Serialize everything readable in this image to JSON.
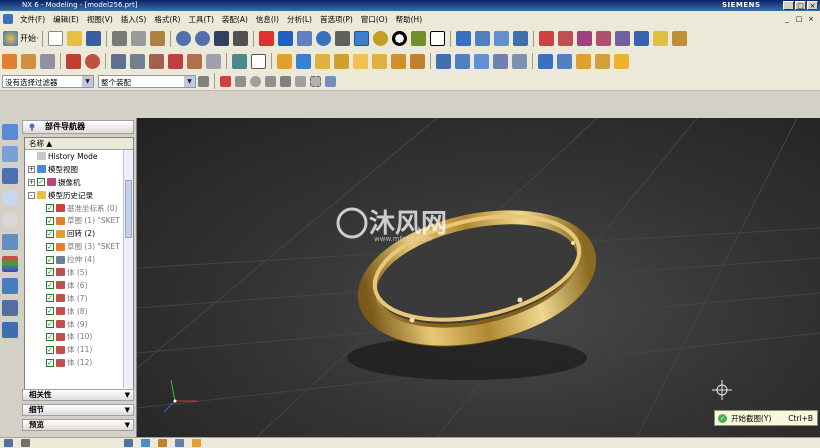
{
  "window": {
    "title": "NX 6 - Modeling - [model256.prt]",
    "brand": "SIEMENS",
    "controls": [
      "_",
      "□",
      "×"
    ]
  },
  "menubar": {
    "items": [
      "文件(F)",
      "编辑(E)",
      "视图(V)",
      "插入(S)",
      "格式(R)",
      "工具(T)",
      "装配(A)",
      "信息(I)",
      "分析(L)",
      "首选项(P)",
      "窗口(O)",
      "帮助(H)"
    ],
    "doc_controls": [
      "_",
      "□",
      "×"
    ]
  },
  "toolbar": {
    "start_label": "开始·"
  },
  "filter_bar": {
    "selection_filter": "没有选择过滤器",
    "assembly_scope": "整个装配"
  },
  "navigator": {
    "title": "部件导航器",
    "column_header": "名称 ▲",
    "tree": [
      {
        "label": "History Mode",
        "indent": 1,
        "icon": "clock-icon"
      },
      {
        "label": "模型视图",
        "indent": 0,
        "expander": "+",
        "icon": "views-icon"
      },
      {
        "label": "摄像机",
        "indent": 0,
        "expander": "+",
        "check": true,
        "icon": "camera-icon"
      },
      {
        "label": "模型历史记录",
        "indent": 0,
        "expander": "-",
        "icon": "folder-icon"
      },
      {
        "label": "基准坐标系 (0)",
        "indent": 2,
        "check": true,
        "icon": "datum-csys-icon",
        "grey": true
      },
      {
        "label": "草图 (1) \"SKET",
        "indent": 2,
        "check": true,
        "icon": "sketch-icon",
        "grey": true
      },
      {
        "label": "回转 (2)",
        "indent": 2,
        "check": true,
        "icon": "revolve-icon"
      },
      {
        "label": "草图 (3) \"SKET",
        "indent": 2,
        "check": true,
        "icon": "sketch-icon",
        "grey": true
      },
      {
        "label": "拉伸 (4)",
        "indent": 2,
        "check": true,
        "icon": "extrude-icon",
        "grey": true
      },
      {
        "label": "体 (5)",
        "indent": 2,
        "check": true,
        "icon": "body-icon",
        "grey": true
      },
      {
        "label": "体 (6)",
        "indent": 2,
        "check": true,
        "icon": "body-icon",
        "grey": true
      },
      {
        "label": "体 (7)",
        "indent": 2,
        "check": true,
        "icon": "body-icon",
        "grey": true
      },
      {
        "label": "体 (8)",
        "indent": 2,
        "check": true,
        "icon": "body-icon",
        "grey": true
      },
      {
        "label": "体 (9)",
        "indent": 2,
        "check": true,
        "icon": "body-icon",
        "grey": true
      },
      {
        "label": "体 (10)",
        "indent": 2,
        "check": true,
        "icon": "body-icon",
        "grey": true
      },
      {
        "label": "体 (11)",
        "indent": 2,
        "check": true,
        "icon": "body-icon",
        "grey": true
      },
      {
        "label": "体 (12)",
        "indent": 2,
        "check": true,
        "icon": "body-icon",
        "grey": true
      }
    ],
    "panels": [
      "相关性",
      "细节",
      "预览"
    ]
  },
  "viewport": {
    "watermark_text": "沐风网",
    "watermark_url": "www.mfcad.com"
  },
  "toast": {
    "label": "开始截图(Y)",
    "shortcut": "Ctrl+B"
  },
  "colors": {
    "viewport_bg": "#333333",
    "ring_gold": "#c9a24a",
    "title_blue": "#0a246a"
  }
}
